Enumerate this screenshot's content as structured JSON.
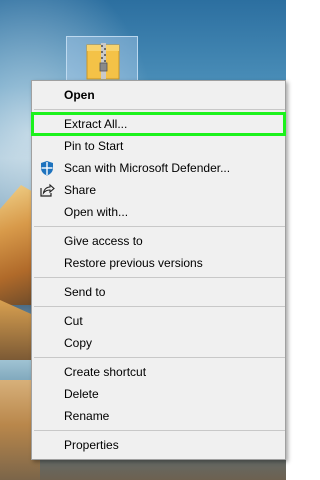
{
  "menu": {
    "open": "Open",
    "extract_all": "Extract All...",
    "pin_to_start": "Pin to Start",
    "scan_defender": "Scan with Microsoft Defender...",
    "share": "Share",
    "open_with": "Open with...",
    "give_access": "Give access to",
    "restore_versions": "Restore previous versions",
    "send_to": "Send to",
    "cut": "Cut",
    "copy": "Copy",
    "create_shortcut": "Create shortcut",
    "delete": "Delete",
    "rename": "Rename",
    "properties": "Properties"
  },
  "icons": {
    "file": "zip-folder-icon",
    "defender": "defender-shield-icon",
    "share": "share-icon"
  },
  "colors": {
    "highlight": "#1cf21c",
    "menu_bg": "#f0f0f0",
    "defender_blue": "#1e73be"
  }
}
